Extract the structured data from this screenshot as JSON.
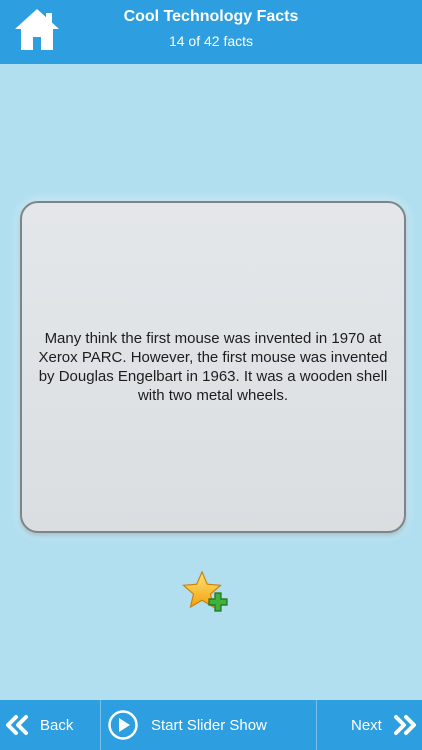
{
  "header": {
    "title": "Cool Technology Facts",
    "subtitle": "14 of 42 facts",
    "home_icon": "home-icon"
  },
  "fact": {
    "text": "Many think the first mouse was invented in 1970 at Xerox PARC. However, the first mouse was invented by Douglas Engelbart in 1963. It was a wooden shell with two metal wheels."
  },
  "favorite": {
    "icon": "star-add-icon"
  },
  "footer": {
    "back_label": "Back",
    "slideshow_label": "Start Slider Show",
    "next_label": "Next",
    "back_icon": "double-chevron-left-icon",
    "play_icon": "play-circle-icon",
    "next_icon": "double-chevron-right-icon"
  },
  "colors": {
    "bar": "#2d9fe0",
    "background": "#b2dff0",
    "card": "#dfe2e5"
  }
}
